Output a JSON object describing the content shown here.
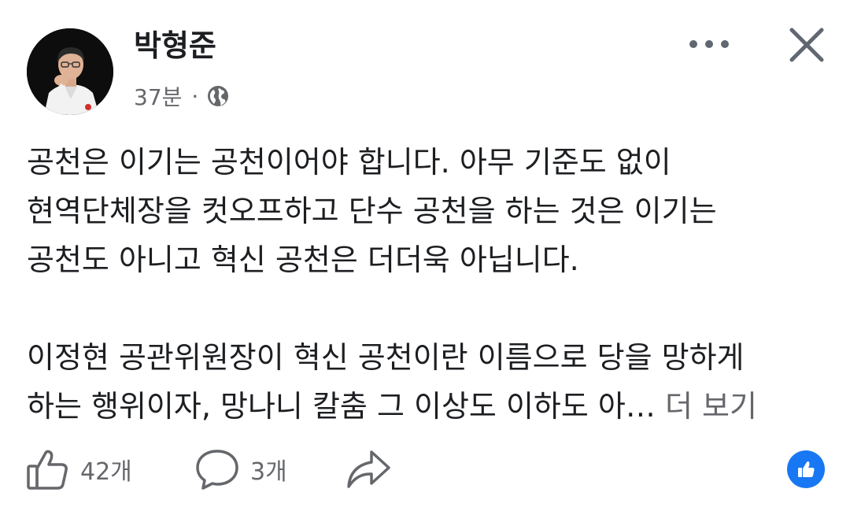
{
  "post": {
    "author": "박형준",
    "time": "37분",
    "separator": "·",
    "privacy_icon": "globe-icon",
    "paragraphs": [
      [
        "공천은 이기는 공천이어야 합니다. 아무 기준도 없이",
        "현역단체장을 컷오프하고 단수 공천을 하는 것은 이기는",
        "공천도 아니고 혁신 공천은 더더욱 아닙니다."
      ],
      [
        "이정현 공관위원장이 혁신 공천이란 이름으로 당을 망하게",
        "하는 행위이자, 망나니 칼춤 그 이상도 이하도 아…"
      ]
    ],
    "see_more": "더 보기"
  },
  "header": {
    "more_icon": "more-horizontal-icon",
    "close_icon": "close-icon"
  },
  "actions": {
    "like_icon": "thumbs-up-icon",
    "like_count": "42개",
    "comment_icon": "comment-bubble-icon",
    "comment_count": "3개",
    "share_icon": "share-arrow-icon",
    "reaction_icon": "like-reaction-icon"
  },
  "colors": {
    "text_primary": "#1c1e21",
    "text_secondary": "#65676b",
    "icon_gray": "#65676b",
    "reaction_blue": "#1877f2"
  }
}
